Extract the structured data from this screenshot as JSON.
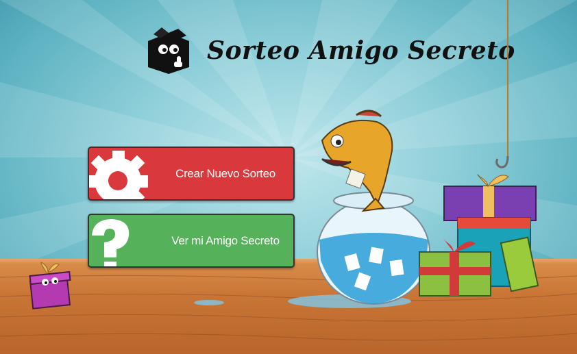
{
  "header": {
    "title": "Sorteo Amigo Secreto",
    "logo_icon": "secret-box-mascot-icon"
  },
  "actions": {
    "create_label": "Crear Nuevo Sorteo",
    "create_icon": "gear-icon",
    "create_color": "#d9393c",
    "view_label": "Ver mi Amigo Secreto",
    "view_icon": "question-mark-icon",
    "view_color": "#55b25a"
  },
  "illustration": {
    "items": [
      "fish-icon",
      "fishbowl-icon",
      "gift-stack-icon",
      "fishing-hook-icon",
      "small-gift-icon"
    ]
  }
}
